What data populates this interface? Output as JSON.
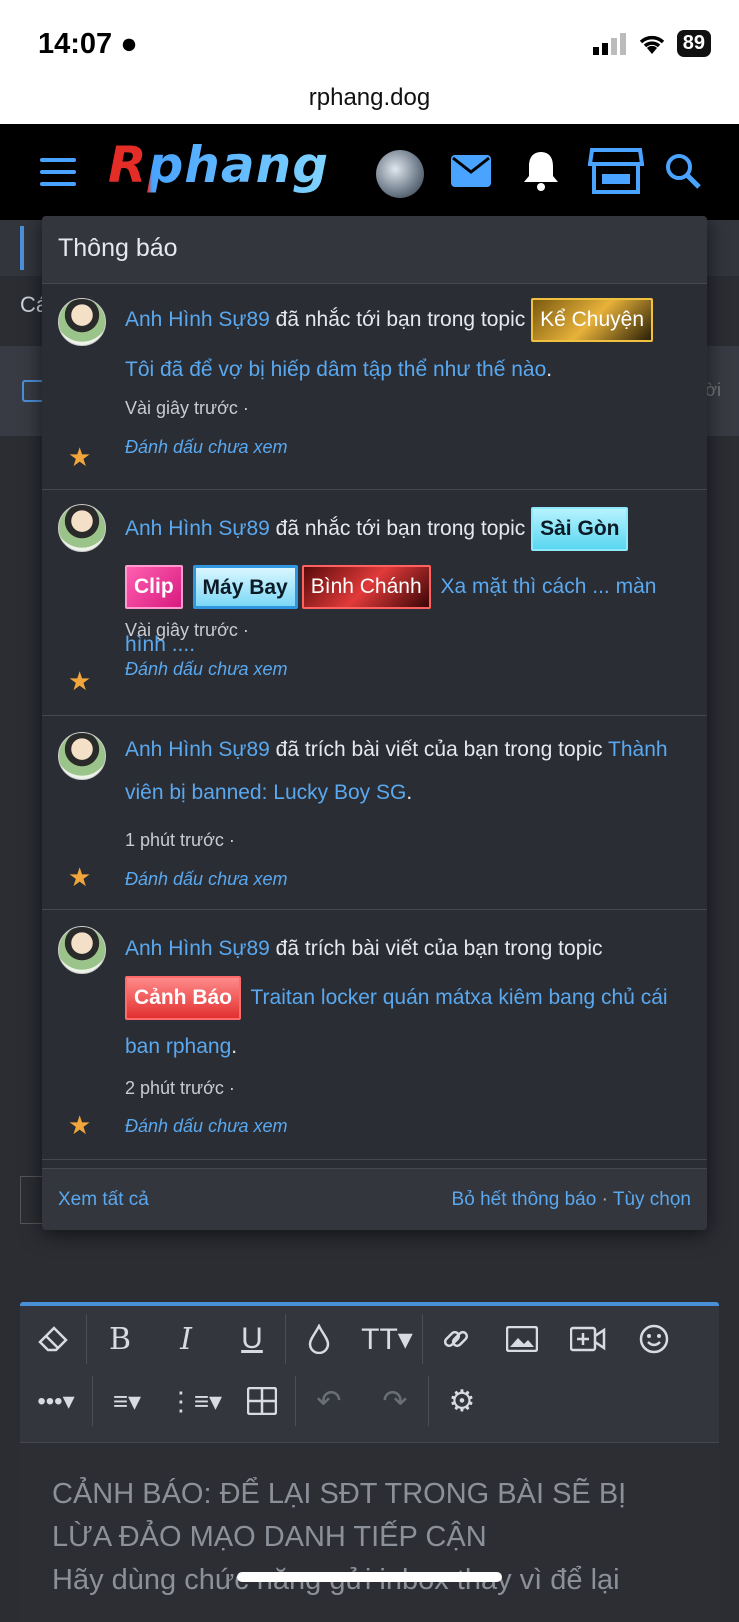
{
  "status_bar": {
    "time": "14:07",
    "battery": "89"
  },
  "browser": {
    "url": "rphang.dog"
  },
  "nav": {
    "logo": "Rphang"
  },
  "background": {
    "partial_label": "Cá",
    "partial_right": "ời"
  },
  "popup": {
    "title": "Thông báo",
    "notifications": [
      {
        "user": "Anh Hình Sự89",
        "action": "đã nhắc tới bạn trong topic",
        "tags": [
          "Kể Chuyện"
        ],
        "topic": "Tôi đã để vợ bị hiếp dâm tập thể như thế nào",
        "time": "Vài giây trước ·",
        "mark_unread": "Đánh dấu chưa xem"
      },
      {
        "user": "Anh Hình Sự89",
        "action": "đã nhắc tới bạn trong topic",
        "tags": [
          "Sài Gòn",
          "Clip",
          "Máy Bay",
          "Bình Chánh"
        ],
        "topic": "Xa mặt thì cách ... màn hình ....",
        "time": "Vài giây trước ·",
        "mark_unread": "Đánh dấu chưa xem"
      },
      {
        "user": "Anh Hình Sự89",
        "action": "đã trích bài viết của bạn trong topic",
        "tags": [],
        "topic": "Thành viên bị banned: Lucky Boy SG",
        "time": "1 phút trước ·",
        "mark_unread": "Đánh dấu chưa xem"
      },
      {
        "user": "Anh Hình Sự89",
        "action": "đã trích bài viết của bạn trong topic",
        "tags": [
          "Cảnh Báo"
        ],
        "topic": "Traitan locker quán mátxa kiêm bang chủ cái ban rphang",
        "time": "2 phút trước ·",
        "mark_unread": "Đánh dấu chưa xem"
      }
    ],
    "footer": {
      "see_all": "Xem tất cả",
      "dismiss_all": "Bỏ hết thông báo",
      "separator": "·",
      "options": "Tùy chọn"
    }
  },
  "editor": {
    "warning_line1": "CẢNH BÁO: ĐỂ LẠI SĐT TRONG BÀI SẼ BỊ",
    "warning_line2": "LỪA ĐẢO MẠO DANH TIẾP CẬN",
    "warning_line3": "Hãy dùng chức năng gửi inbox thay vì để lại"
  },
  "icons": {
    "nav": [
      "menu-icon",
      "mail-icon",
      "bell-icon",
      "store-icon",
      "search-icon"
    ],
    "toolbar": [
      "eraser-icon",
      "bold-icon",
      "italic-icon",
      "underline-icon",
      "color-drop-icon",
      "text-size-icon",
      "link-icon",
      "image-icon",
      "video-icon",
      "smiley-icon",
      "more-icon",
      "align-icon",
      "list-icon",
      "table-icon",
      "undo-icon",
      "redo-icon",
      "settings-icon"
    ]
  },
  "colors": {
    "accent": "#5aa8ef",
    "star": "#f0a63b",
    "panel": "#2a2d33"
  }
}
